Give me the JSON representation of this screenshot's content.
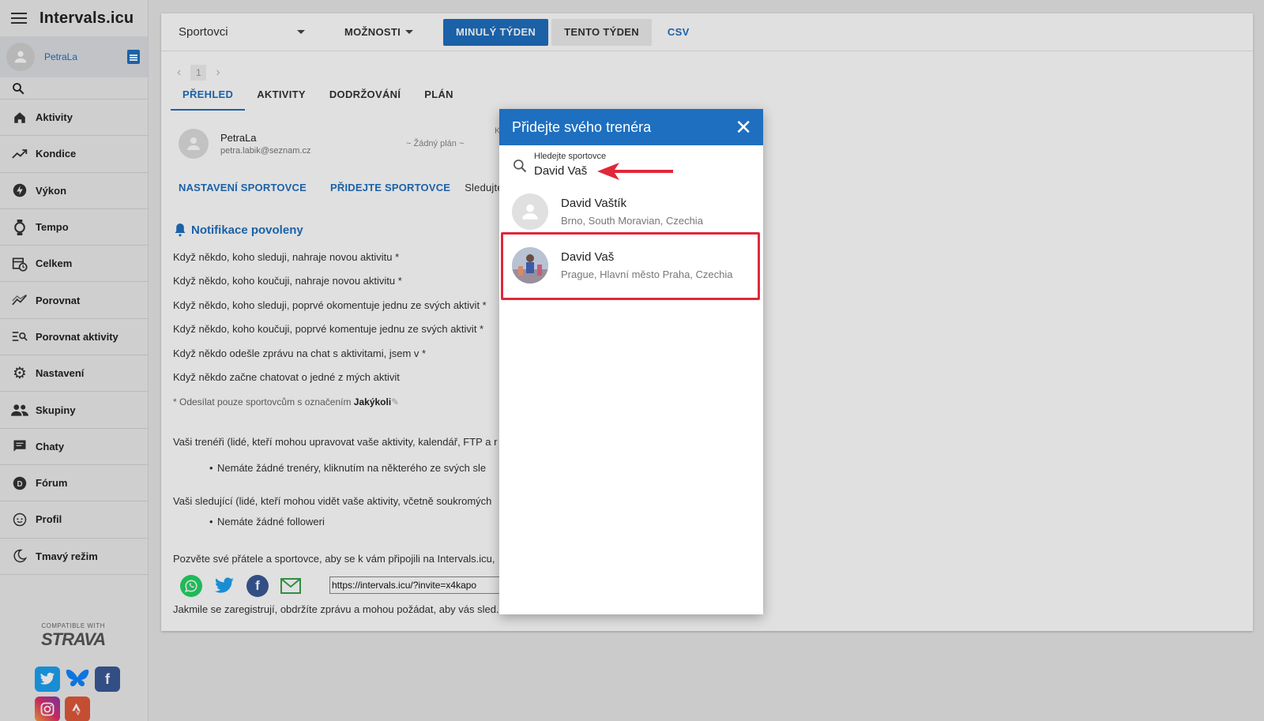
{
  "app": {
    "title": "Intervals.icu"
  },
  "sidebar": {
    "user_name": "PetraLa",
    "items": [
      {
        "label": "Aktivity",
        "icon": "home-icon"
      },
      {
        "label": "Kondice",
        "icon": "trend-icon"
      },
      {
        "label": "Výkon",
        "icon": "bolt-icon"
      },
      {
        "label": "Tempo",
        "icon": "watch-icon"
      },
      {
        "label": "Celkem",
        "icon": "calendar-clock-icon"
      },
      {
        "label": "Porovnat",
        "icon": "compare-icon"
      },
      {
        "label": "Porovnat aktivity",
        "icon": "search-list-icon"
      },
      {
        "label": "Nastavení",
        "icon": "gear-icon"
      },
      {
        "label": "Skupiny",
        "icon": "group-icon"
      },
      {
        "label": "Chaty",
        "icon": "chat-icon"
      },
      {
        "label": "Fórum",
        "icon": "forum-icon"
      },
      {
        "label": "Profil",
        "icon": "face-icon"
      },
      {
        "label": "Tmavý režim",
        "icon": "moon-icon"
      }
    ],
    "strava_small": "COMPATIBLE WITH",
    "strava_big": "STRAVA"
  },
  "toolbar": {
    "select_value": "Sportovci",
    "options_label": "MOŽNOSTI",
    "last_week_label": "MINULÝ TÝDEN",
    "this_week_label": "TENTO TÝDEN",
    "csv_label": "CSV"
  },
  "pager": {
    "page": "1"
  },
  "tabs": [
    "PŘEHLED",
    "AKTIVITY",
    "DODRŽOVÁNÍ",
    "PLÁN"
  ],
  "profile": {
    "name": "PetraLa",
    "email": "petra.labik@seznam.cz",
    "plan": "~ Žádný plán ~",
    "partial": "K"
  },
  "links": {
    "settings": "NASTAVENÍ SPORTOVCE",
    "add": "PŘIDEJTE SPORTOVCE",
    "follow": "Sledujte sv"
  },
  "notifications": {
    "heading": "Notifikace povoleny",
    "lines": [
      "Když někdo, koho sleduji, nahraje novou aktivitu *",
      "Když někdo, koho koučuji, nahraje novou aktivitu *",
      "Když někdo, koho sleduji, poprvé okomentuje jednu ze svých aktivit *",
      "Když někdo, koho koučuji, poprvé komentuje jednu ze svých aktivit *",
      "Když někdo odešle zprávu na chat s aktivitami, jsem v *",
      "Když někdo začne chatovat o jedné z mých aktivit"
    ],
    "note_prefix": "* Odesílat pouze sportovcům s označením",
    "note_value": "Jakýkoli"
  },
  "coaches": {
    "text": "Vaši trenéři (lidé, kteří mohou upravovat vaše aktivity, kalendář, FTP a r",
    "bullet": "Nemáte žádné trenéry, kliknutím na některého ze svých sle"
  },
  "followers": {
    "text": "Vaši sledující (lidé, kteří mohou vidět vaše aktivity, včetně soukromých",
    "bullet": "Nemáte žádné followeri"
  },
  "invite": {
    "text": "Pozvěte své přátele a sportovce, aby se k vám připojili na Intervals.icu,",
    "url": "https://intervals.icu/?invite=x4kapo",
    "after": "Jakmile se zaregistrují, obdržíte zprávu a mohou požádat, aby vás sled..."
  },
  "dialog": {
    "title": "Přidejte svého trenéra",
    "search_label": "Hledejte sportovce",
    "search_value": "David Vaš",
    "results": [
      {
        "name": "David Vaštík",
        "location": "Brno, South Moravian, Czechia"
      },
      {
        "name": "David Vaš",
        "location": "Prague, Hlavní město Praha, Czechia"
      }
    ]
  },
  "colors": {
    "accent": "#1e6fc0",
    "highlight": "#e0283a"
  }
}
